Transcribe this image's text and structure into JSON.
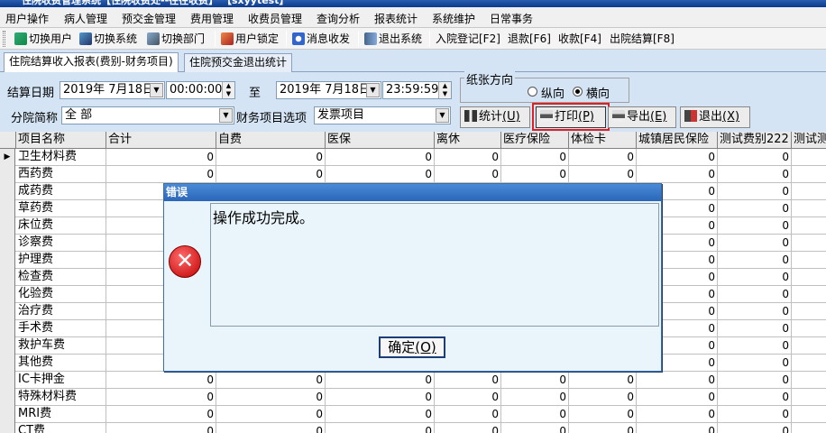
{
  "titlebar": {
    "title": "住院收费管理系统【住院收费处--往往收费】   【sxyytest】"
  },
  "menu": {
    "items": [
      "用户操作",
      "病人管理",
      "预交金管理",
      "费用管理",
      "收费员管理",
      "查询分析",
      "报表统计",
      "系统维护",
      "日常事务"
    ]
  },
  "toolbar": {
    "switch_user": "切换用户",
    "switch_system": "切换系统",
    "switch_dept": "切换部门",
    "user_lock": "用户锁定",
    "message": "消息收发",
    "exit_system": "退出系统",
    "admission": "入院登记[F2]",
    "refund": "退款[F6]",
    "charge": "收款[F4]",
    "discharge": "出院结算[F8]"
  },
  "tabs": [
    {
      "label": "住院结算收入报表(费别-财务项目)",
      "active": true
    },
    {
      "label": "住院预交金退出统计",
      "active": false
    }
  ],
  "filters": {
    "settle_date_label": "结算日期",
    "start_date": "2019年  7月18日",
    "start_time": "00:00:00",
    "to_label": "至",
    "end_date": "2019年  7月18日",
    "end_time": "23:59:59",
    "branch_label": "分院简称",
    "branch_value": "全 部",
    "finance_label": "财务项目选项",
    "finance_value": "发票项目"
  },
  "paper": {
    "legend": "纸张方向",
    "portrait": "纵向",
    "landscape": "横向",
    "selected": "landscape"
  },
  "buttons": {
    "stat_text": "统计",
    "stat_key": "(U)",
    "print_text": "打印",
    "print_key": "(P)",
    "export_text": "导出",
    "export_key": "(E)",
    "exit_text": "退出",
    "exit_key": "(X)"
  },
  "grid": {
    "columns": [
      "项目名称",
      "合计",
      "自费",
      "医保",
      "离休",
      "医疗保险",
      "体检卡",
      "城镇居民保险",
      "测试费别222",
      "测试测"
    ],
    "rows": [
      {
        "name": "卫生材料费",
        "values": [
          "0",
          "0",
          "0",
          "0",
          "0",
          "0",
          "0",
          "0"
        ]
      },
      {
        "name": "西药费",
        "values": [
          "0",
          "0",
          "0",
          "0",
          "0",
          "0",
          "0",
          "0"
        ]
      },
      {
        "name": "成药费",
        "values": [
          "",
          "",
          "",
          "",
          "",
          "",
          "0",
          "0"
        ]
      },
      {
        "name": "草药费",
        "values": [
          "",
          "",
          "",
          "",
          "",
          "",
          "0",
          "0"
        ]
      },
      {
        "name": "床位费",
        "values": [
          "",
          "",
          "",
          "",
          "",
          "",
          "0",
          "0"
        ]
      },
      {
        "name": "诊察费",
        "values": [
          "",
          "",
          "",
          "",
          "",
          "",
          "0",
          "0"
        ]
      },
      {
        "name": "护理费",
        "values": [
          "",
          "",
          "",
          "",
          "",
          "",
          "0",
          "0"
        ]
      },
      {
        "name": "检查费",
        "values": [
          "",
          "",
          "",
          "",
          "",
          "",
          "0",
          "0"
        ]
      },
      {
        "name": "化验费",
        "values": [
          "",
          "",
          "",
          "",
          "",
          "",
          "0",
          "0"
        ]
      },
      {
        "name": "治疗费",
        "values": [
          "",
          "",
          "",
          "",
          "",
          "",
          "0",
          "0"
        ]
      },
      {
        "name": "手术费",
        "values": [
          "",
          "",
          "",
          "",
          "",
          "",
          "0",
          "0"
        ]
      },
      {
        "name": "救护车费",
        "values": [
          "",
          "",
          "",
          "",
          "",
          "",
          "0",
          "0"
        ]
      },
      {
        "name": "其他费",
        "values": [
          "",
          "",
          "",
          "",
          "",
          "",
          "0",
          "0"
        ]
      },
      {
        "name": "IC卡押金",
        "values": [
          "0",
          "0",
          "0",
          "0",
          "0",
          "0",
          "0",
          "0"
        ]
      },
      {
        "name": "特殊材料费",
        "values": [
          "0",
          "0",
          "0",
          "0",
          "0",
          "0",
          "0",
          "0"
        ]
      },
      {
        "name": "MRI费",
        "values": [
          "0",
          "0",
          "0",
          "0",
          "0",
          "0",
          "0",
          "0"
        ]
      },
      {
        "name": "CT费",
        "values": [
          "0",
          "0",
          "0",
          "0",
          "0",
          "0",
          "0",
          "0"
        ]
      }
    ]
  },
  "dialog": {
    "title": "错误",
    "message": "操作成功完成。",
    "icon": "error-icon",
    "ok_text": "确定",
    "ok_key": "(O)"
  },
  "colors": {
    "background": "#d4e4f4",
    "highlight_border": "#e02020",
    "dialog_title": "#2a66b8"
  }
}
